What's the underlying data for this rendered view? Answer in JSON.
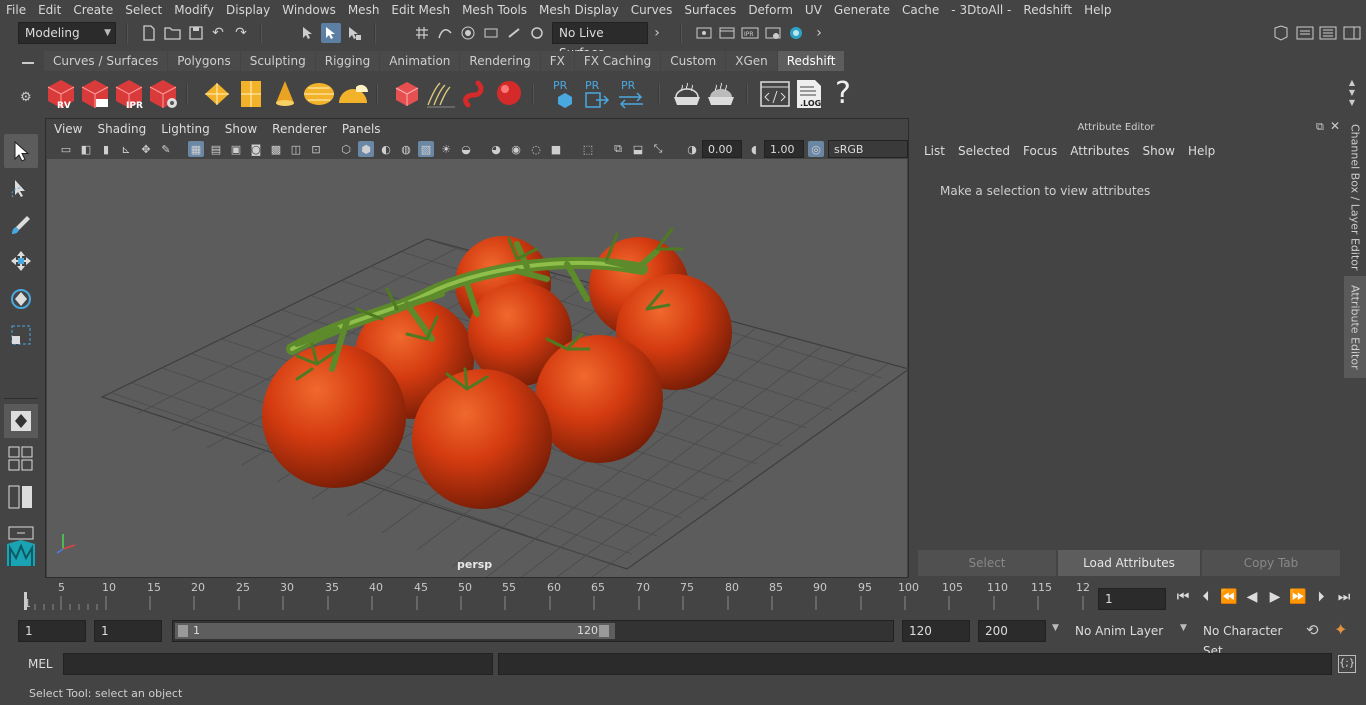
{
  "menus": [
    "File",
    "Edit",
    "Create",
    "Select",
    "Modify",
    "Display",
    "Windows",
    "Mesh",
    "Edit Mesh",
    "Mesh Tools",
    "Mesh Display",
    "Curves",
    "Surfaces",
    "Deform",
    "UV",
    "Generate",
    "Cache",
    "- 3DtoAll -",
    "Redshift",
    "Help"
  ],
  "status": {
    "mode": "Modeling",
    "live_surface": "No Live Surface"
  },
  "shelf_tabs": [
    "Curves / Surfaces",
    "Polygons",
    "Sculpting",
    "Rigging",
    "Animation",
    "Rendering",
    "FX",
    "FX Caching",
    "Custom",
    "XGen",
    "Redshift"
  ],
  "shelf_icons": {
    "rv": "RV",
    "ipr": "IPR",
    "pr": "PR",
    "log": ".LOG",
    "help": "?"
  },
  "viewport": {
    "menus": [
      "View",
      "Shading",
      "Lighting",
      "Show",
      "Renderer",
      "Panels"
    ],
    "exposure": "0.00",
    "gamma": "1.00",
    "color_space": "sRGB gamma",
    "camera": "persp"
  },
  "attr_editor": {
    "title": "Attribute Editor",
    "menus": [
      "List",
      "Selected",
      "Focus",
      "Attributes",
      "Show",
      "Help"
    ],
    "message": "Make a selection to view attributes",
    "buttons": {
      "select": "Select",
      "load": "Load Attributes",
      "copy": "Copy Tab"
    }
  },
  "side_tabs": {
    "channel_box": "Channel Box / Layer Editor",
    "attribute_editor": "Attribute Editor"
  },
  "timeline": {
    "ticks": [
      "5",
      "10",
      "15",
      "20",
      "25",
      "30",
      "35",
      "40",
      "45",
      "50",
      "55",
      "60",
      "65",
      "70",
      "75",
      "80",
      "85",
      "90",
      "95",
      "100",
      "105",
      "110",
      "115",
      "12"
    ],
    "current_marker": "1",
    "current_frame": "1"
  },
  "range": {
    "start": "1",
    "anim_start": "1",
    "slider_start": "1",
    "slider_end": "120",
    "end": "120",
    "anim_end": "200",
    "anim_layer": "No Anim Layer",
    "character_set": "No Character Set"
  },
  "cmd": {
    "lang": "MEL"
  },
  "help_line": "Select Tool: select an object",
  "colors": {
    "tomato": "#d43b10",
    "vine": "#5d8a2a",
    "accent": "#5d7fa3"
  }
}
